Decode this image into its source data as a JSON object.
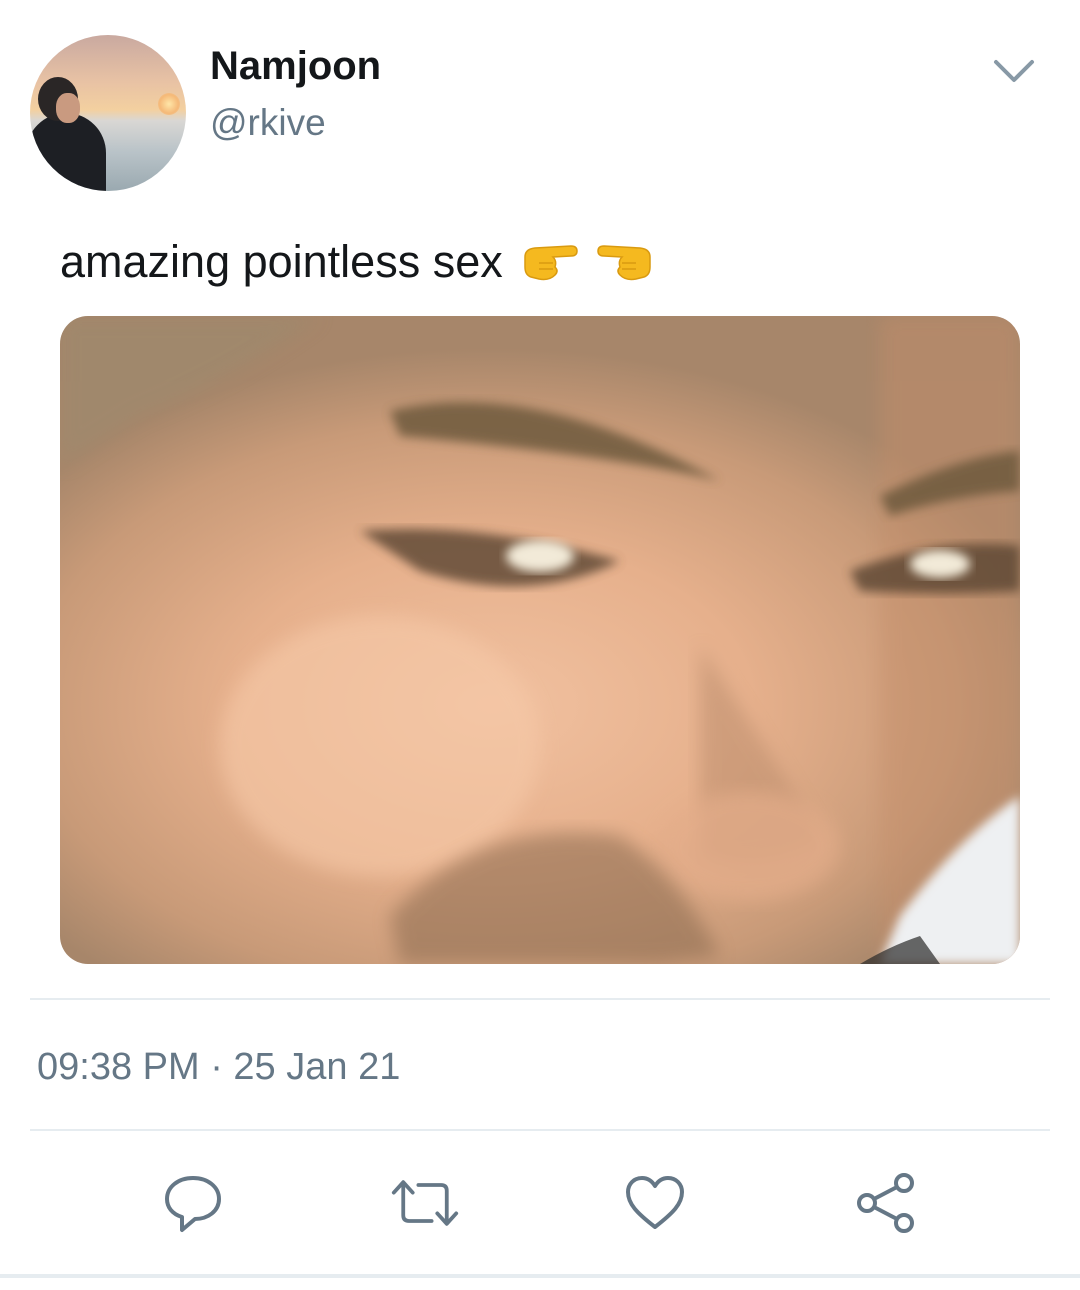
{
  "tweet": {
    "author": {
      "name": "Namjoon",
      "handle": "@rkive"
    },
    "text": "amazing pointless sex",
    "text_emoji": [
      "backhand-index-pointing-right",
      "backhand-index-pointing-left"
    ],
    "timestamp": "09:38 PM · 25 Jan 21"
  },
  "icons": {
    "menu": "chevron-down-icon",
    "reply": "speech-bubble-icon",
    "retweet": "retweet-icon",
    "like": "heart-icon",
    "share": "share-nodes-icon"
  },
  "colors": {
    "text_primary": "#14171a",
    "text_secondary": "#657786",
    "icon": "#657786",
    "divider": "#e6ecf0",
    "emoji": "#f5b91f"
  }
}
